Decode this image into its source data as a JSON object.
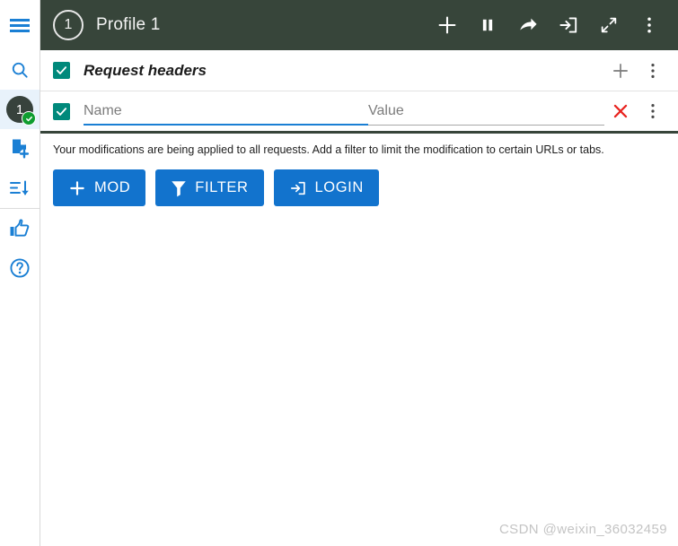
{
  "rail": {
    "menu": {
      "icon": "hamburger-menu-icon",
      "label": "Menu"
    },
    "items": [
      {
        "icon": "search-icon",
        "label": "Search",
        "selected": false
      },
      {
        "icon": "profile-badge-icon",
        "label": "Profile 1",
        "selected": true,
        "badge": "1",
        "status": "active"
      },
      {
        "icon": "document-add-icon",
        "label": "New profile",
        "selected": false
      },
      {
        "icon": "sort-descending-icon",
        "label": "Sort",
        "selected": false
      },
      {
        "icon": "thumbs-up-icon",
        "label": "Rate",
        "selected": false
      },
      {
        "icon": "help-circle-icon",
        "label": "Help",
        "selected": false
      }
    ]
  },
  "topbar": {
    "profile_number": "1",
    "profile_name": "Profile 1",
    "background": "#37453a",
    "actions": [
      {
        "icon": "plus-icon",
        "label": "Add"
      },
      {
        "icon": "pause-icon",
        "label": "Pause"
      },
      {
        "icon": "share-arrow-icon",
        "label": "Share"
      },
      {
        "icon": "sign-in-icon",
        "label": "Sign in"
      },
      {
        "icon": "expand-icon",
        "label": "Expand"
      },
      {
        "icon": "kebab-menu-icon",
        "label": "More options"
      }
    ]
  },
  "section": {
    "title": "Request headers",
    "enabled": true,
    "checkbox_color": "#00897b",
    "add_icon": "plus-icon",
    "add_label": "Add header",
    "menu_icon": "kebab-menu-icon",
    "menu_label": "More options"
  },
  "header_row": {
    "enabled": true,
    "name": {
      "value": "",
      "placeholder": "Name",
      "focused": true,
      "underline_color": "#1a7fd4"
    },
    "value": {
      "value": "",
      "placeholder": "Value",
      "focused": false,
      "underline_color": "#a8a8a8"
    },
    "delete_icon": "close-x-icon",
    "delete_label": "Remove header",
    "menu_icon": "kebab-menu-icon",
    "menu_label": "More options"
  },
  "info": {
    "text": "Your modifications are being applied to all requests. Add a filter to limit the modification to certain URLs or tabs."
  },
  "buttons": [
    {
      "label": "MOD",
      "icon": "plus-icon",
      "color": "#1273cd"
    },
    {
      "label": "FILTER",
      "icon": "funnel-icon",
      "color": "#1273cd"
    },
    {
      "label": "LOGIN",
      "icon": "sign-in-icon",
      "color": "#1273cd"
    }
  ],
  "watermark": "CSDN @weixin_36032459"
}
